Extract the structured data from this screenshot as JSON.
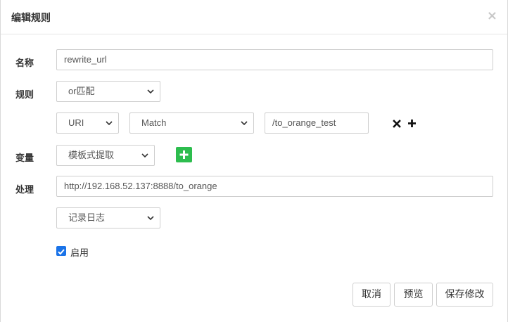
{
  "dialog": {
    "title": "编辑规则",
    "close_glyph": "×"
  },
  "form": {
    "name": {
      "label": "名称",
      "value": "rewrite_url"
    },
    "rule": {
      "label": "规则",
      "operator": "or匹配",
      "condition": {
        "type": "URI",
        "match": "Match",
        "value": "/to_orange_test"
      },
      "remove_icon": "remove-icon",
      "add_icon": "plus-icon"
    },
    "variable": {
      "label": "变量",
      "mode": "模板式提取",
      "add_icon": "plus-icon",
      "add_button_color": "#2dbd4e"
    },
    "handle": {
      "label": "处理",
      "url": "http://192.168.52.137:8888/to_orange",
      "log": "记录日志"
    },
    "enable": {
      "label": "启用",
      "checked": true,
      "color": "#1a73e8"
    }
  },
  "footer": {
    "cancel": "取消",
    "preview": "预览",
    "save": "保存修改"
  }
}
